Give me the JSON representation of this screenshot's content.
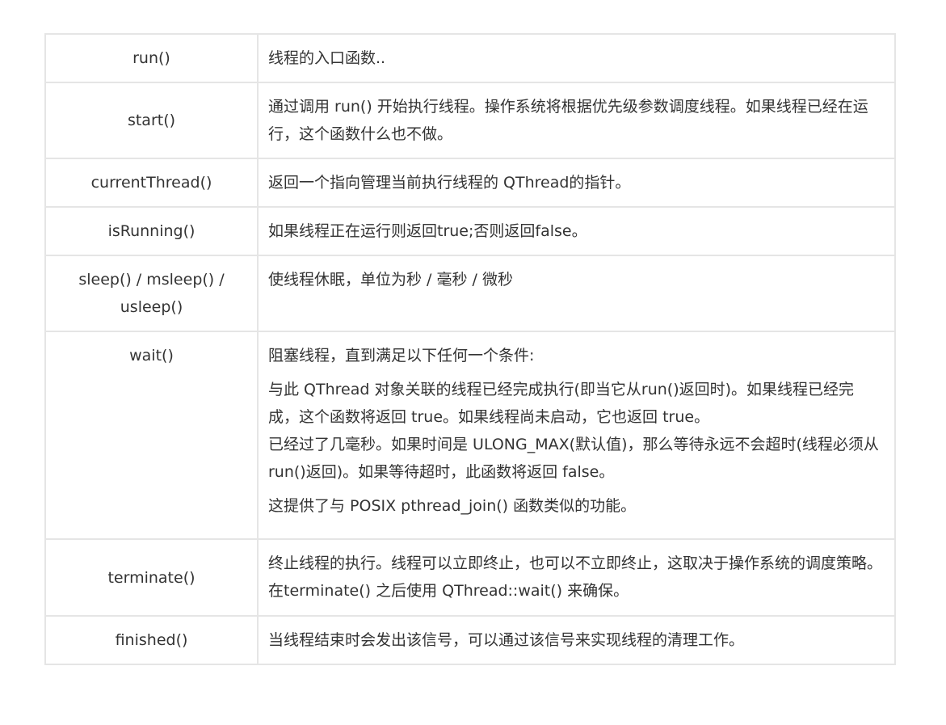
{
  "rows": [
    {
      "name": "run()",
      "desc": [
        "线程的入口函数.."
      ]
    },
    {
      "name": "start()",
      "desc": [
        "通过调用 run() 开始执行线程。操作系统将根据优先级参数调度线程。如果线程已经在运行，这个函数什么也不做。"
      ]
    },
    {
      "name": "currentThread()",
      "desc": [
        "返回一个指向管理当前执行线程的 QThread的指针。"
      ]
    },
    {
      "name": "isRunning()",
      "desc": [
        "如果线程正在运行则返回true;否则返回false。"
      ]
    },
    {
      "name": "sleep() / msleep() / usleep()",
      "desc": [
        "使线程休眠，单位为秒 / 毫秒 / 微秒"
      ]
    },
    {
      "name": "wait()",
      "desc": [
        "阻塞线程，直到满足以下任何一个条件:",
        "与此 QThread 对象关联的线程已经完成执行(即当它从run()返回时)。如果线程已经完成，这个函数将返回 true。如果线程尚未启动，它也返回 true。",
        "已经过了几毫秒。如果时间是 ULONG_MAX(默认值)，那么等待永远不会超时(线程必须从run()返回)。如果等待超时，此函数将返回 false。",
        "这提供了与 POSIX pthread_join() 函数类似的功能。"
      ]
    },
    {
      "name": "terminate()",
      "desc": [
        "终止线程的执行。线程可以立即终止，也可以不立即终止，这取决于操作系统的调度策略。在terminate() 之后使用 QThread::wait() 来确保。"
      ]
    },
    {
      "name": "finished()",
      "desc": [
        "当线程结束时会发出该信号，可以通过该信号来实现线程的清理工作。"
      ]
    }
  ]
}
